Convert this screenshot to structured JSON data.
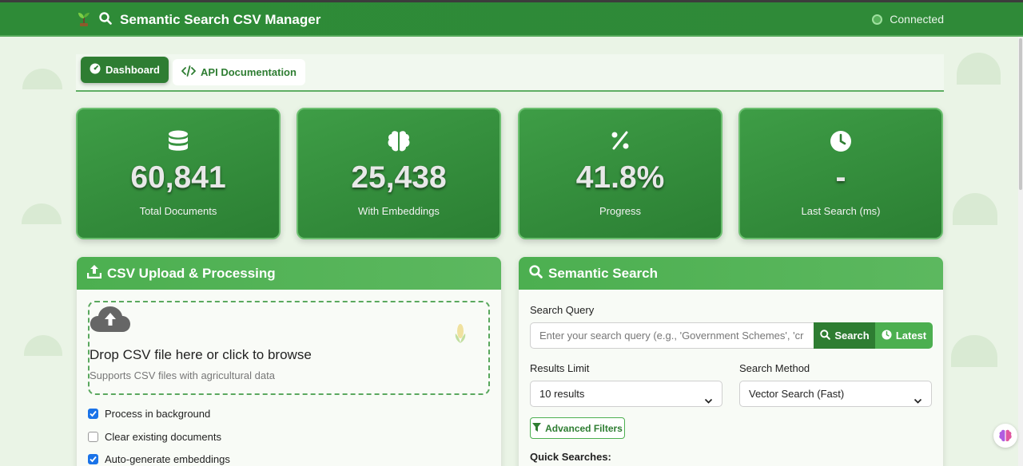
{
  "app": {
    "title": "Semantic Search CSV Manager",
    "status": "Connected"
  },
  "tabs": [
    {
      "label": "Dashboard",
      "icon": "gauge-icon",
      "active": true
    },
    {
      "label": "API Documentation",
      "icon": "code-icon",
      "active": false
    }
  ],
  "stats": [
    {
      "value": "60,841",
      "label": "Total Documents",
      "icon": "database-icon"
    },
    {
      "value": "25,438",
      "label": "With Embeddings",
      "icon": "brain-icon"
    },
    {
      "value": "41.8%",
      "label": "Progress",
      "icon": "percent-icon"
    },
    {
      "value": "-",
      "label": "Last Search (ms)",
      "icon": "clock-icon"
    }
  ],
  "upload": {
    "title": "CSV Upload & Processing",
    "drop_title": "Drop CSV file here or click to browse",
    "drop_sub": "Supports CSV files with agricultural data",
    "options": [
      {
        "label": "Process in background",
        "checked": true
      },
      {
        "label": "Clear existing documents",
        "checked": false
      },
      {
        "label": "Auto-generate embeddings",
        "checked": true
      }
    ]
  },
  "search": {
    "title": "Semantic Search",
    "query_label": "Search Query",
    "placeholder": "Enter your search query (e.g., 'Government Schemes', 'cr",
    "search_btn": "Search",
    "latest_btn": "Latest",
    "limit_label": "Results Limit",
    "limit_value": "10 results",
    "method_label": "Search Method",
    "method_value": "Vector Search (Fast)",
    "filters_btn": "Advanced Filters",
    "quick_label": "Quick Searches:"
  },
  "colors": {
    "primary": "#2e7d32",
    "accent": "#4caf50",
    "background": "#eaf4e6"
  }
}
